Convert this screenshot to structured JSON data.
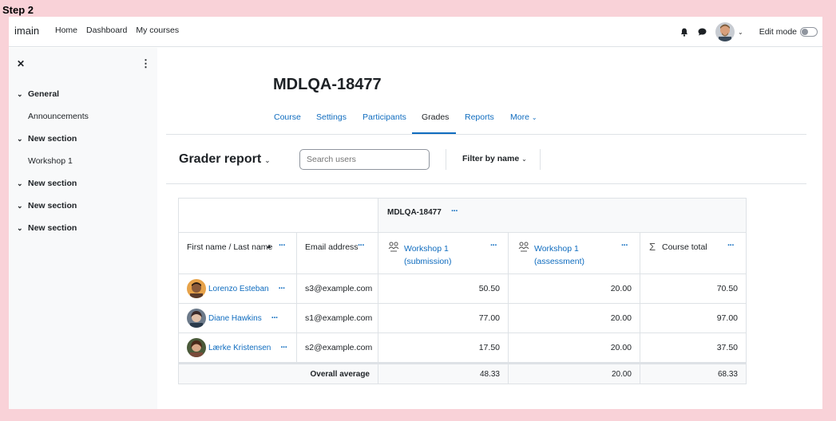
{
  "step_label": "Step 2",
  "navbar": {
    "brand": "imain",
    "links": [
      "Home",
      "Dashboard",
      "My courses"
    ],
    "edit_mode_label": "Edit mode"
  },
  "drawer": {
    "items": [
      {
        "type": "section",
        "label": "General"
      },
      {
        "type": "child",
        "label": "Announcements"
      },
      {
        "type": "section",
        "label": "New section"
      },
      {
        "type": "child",
        "label": "Workshop 1"
      },
      {
        "type": "section",
        "label": "New section"
      },
      {
        "type": "section",
        "label": "New section"
      },
      {
        "type": "section",
        "label": "New section"
      }
    ]
  },
  "course": {
    "title": "MDLQA-18477",
    "tabs": [
      "Course",
      "Settings",
      "Participants",
      "Grades",
      "Reports",
      "More"
    ],
    "active_tab": "Grades"
  },
  "grader": {
    "title": "Grader report",
    "search_placeholder": "Search users",
    "filter_label": "Filter by name"
  },
  "table": {
    "category": "MDLQA-18477",
    "headers": {
      "name": "First name / Last name",
      "email": "Email address",
      "item1_line1": "Workshop 1",
      "item1_line2": "(submission)",
      "item2_line1": "Workshop 1",
      "item2_line2": "(assessment)",
      "total": "Course total"
    },
    "rows": [
      {
        "name": "Lorenzo Esteban",
        "email": "s3@example.com",
        "g1": "50.50",
        "g2": "20.00",
        "total": "70.50"
      },
      {
        "name": "Diane Hawkins",
        "email": "s1@example.com",
        "g1": "77.00",
        "g2": "20.00",
        "total": "97.00"
      },
      {
        "name": "Lærke Kristensen",
        "email": "s2@example.com",
        "g1": "17.50",
        "g2": "20.00",
        "total": "37.50"
      }
    ],
    "average": {
      "label": "Overall average",
      "g1": "48.33",
      "g2": "20.00",
      "total": "68.33"
    }
  },
  "colors": {
    "background": "#f9d2d8",
    "link": "#0f6cbf",
    "border": "#dee2e6"
  }
}
